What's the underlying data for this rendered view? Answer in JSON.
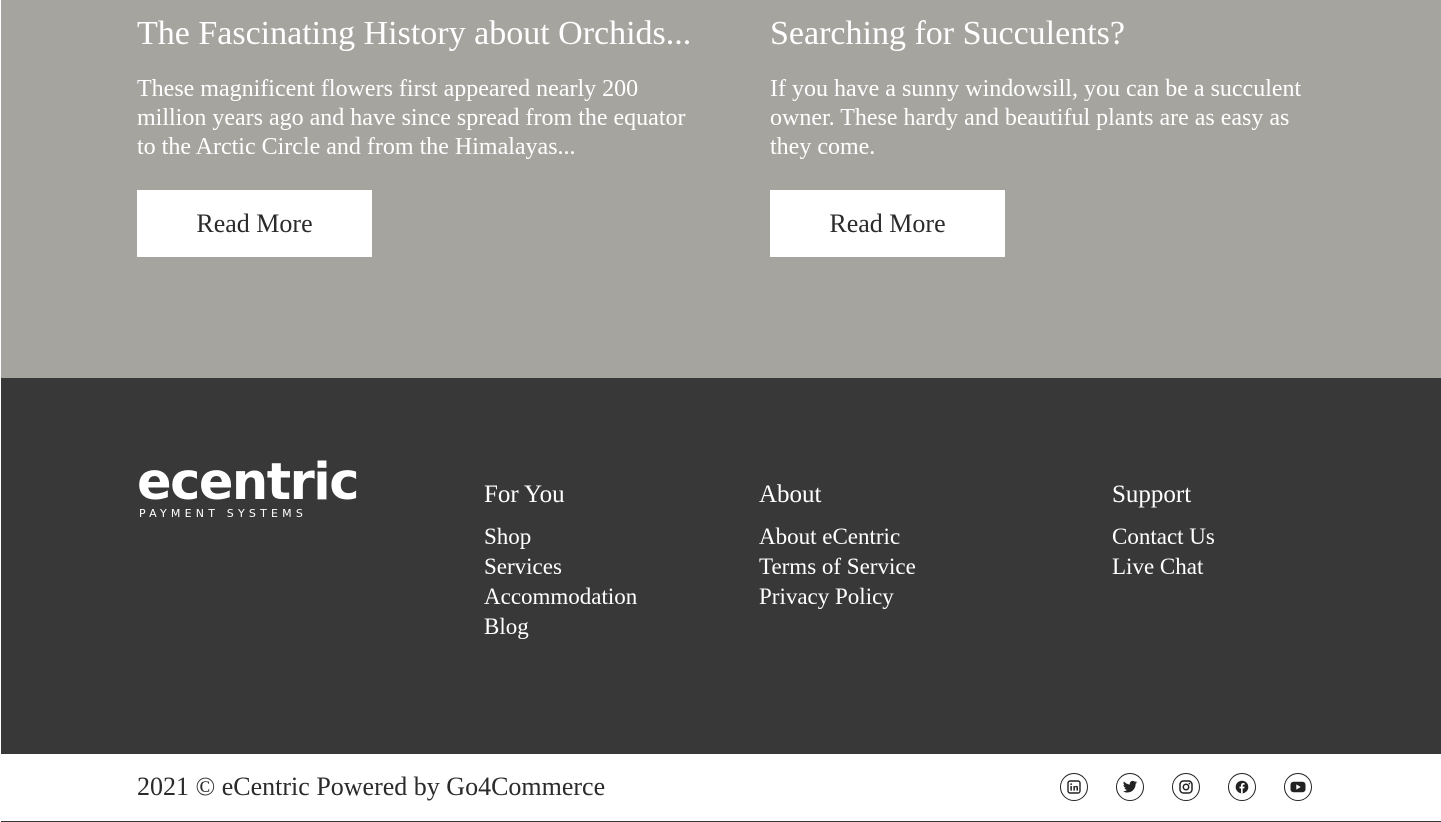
{
  "blog": {
    "posts": [
      {
        "title": "The Fascinating History about Orchids...",
        "excerpt": "These magnificent flowers first appeared nearly 200 million years ago and have since spread from the equator to the Arctic Circle and from the Himalayas...",
        "button_label": "Read More"
      },
      {
        "title": "Searching for Succulents?",
        "excerpt": "If you have a sunny windowsill, you can be a succulent owner. These hardy and beautiful plants are as easy as they come.",
        "button_label": "Read More"
      }
    ]
  },
  "footer": {
    "logo": {
      "name": "ecentric",
      "tagline": "PAYMENT SYSTEMS"
    },
    "columns": [
      {
        "heading": "For You",
        "links": [
          "Shop",
          "Services",
          "Accommodation",
          "Blog"
        ]
      },
      {
        "heading": "About",
        "links": [
          "About eCentric",
          "Terms of Service",
          "Privacy Policy"
        ]
      },
      {
        "heading": "Support",
        "links": [
          "Contact Us",
          "Live Chat"
        ]
      }
    ]
  },
  "bottom_bar": {
    "copyright": "2021 © eCentric Powered by Go4Commerce",
    "social_icons": [
      "linkedin-icon",
      "twitter-icon",
      "instagram-icon",
      "facebook-icon",
      "youtube-icon"
    ]
  },
  "colors": {
    "blog_background": "#a5a49f",
    "footer_background": "#383838",
    "bottom_background": "#ffffff",
    "text_light": "#ffffff",
    "text_dark": "#2b2b2b"
  }
}
